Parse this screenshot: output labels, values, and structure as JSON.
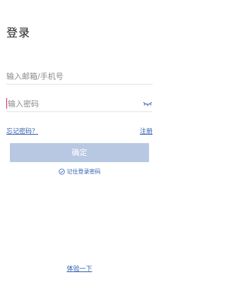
{
  "page": {
    "title": "登录"
  },
  "form": {
    "account_placeholder": "输入邮箱/手机号",
    "password_placeholder": "输入密码",
    "forgot_label": "忘记密码？",
    "register_label": "注册",
    "confirm_label": "确定",
    "remember_label": "记住登录密码",
    "remember_checked": false
  },
  "footer": {
    "trial_label": "体验一下"
  },
  "colors": {
    "accent": "#2f5fb0",
    "button_disabled": "#b8c8e2",
    "caret": "#e0225a"
  },
  "icons": {
    "password_toggle": "eye-closed-icon",
    "remember_check": "check-circle-icon"
  }
}
